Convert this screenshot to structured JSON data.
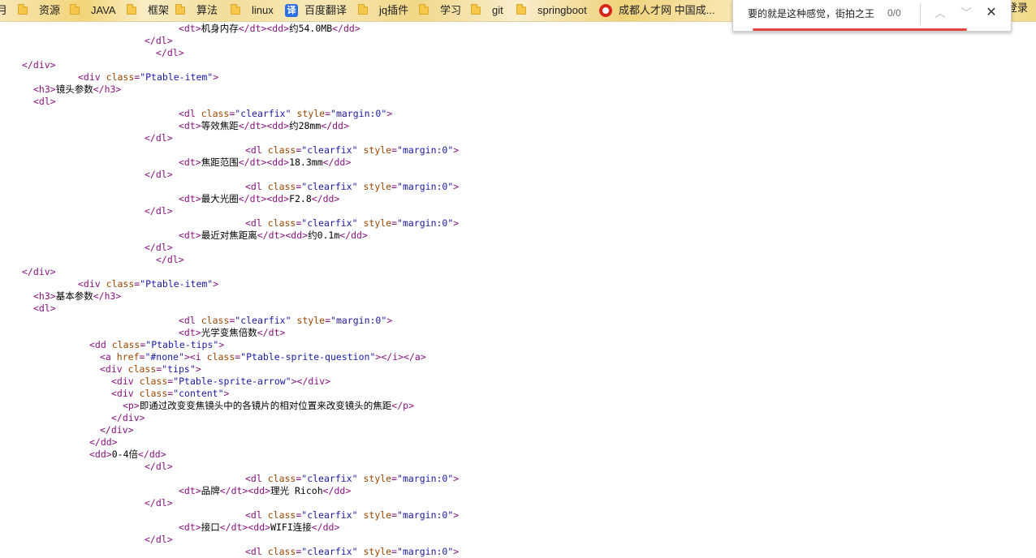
{
  "bookmarks": {
    "items": [
      {
        "label": "月",
        "icon": "folder-icon"
      },
      {
        "label": "资源",
        "icon": "folder-icon"
      },
      {
        "label": "JAVA",
        "icon": "folder-icon"
      },
      {
        "label": "框架",
        "icon": "folder-icon"
      },
      {
        "label": "算法",
        "icon": "folder-icon"
      },
      {
        "label": "linux",
        "icon": "folder-icon"
      },
      {
        "label": "百度翻译",
        "icon": "translate-icon"
      },
      {
        "label": "jq插件",
        "icon": "folder-icon"
      },
      {
        "label": "学习",
        "icon": "folder-icon"
      },
      {
        "label": "git",
        "icon": "folder-icon"
      },
      {
        "label": "springboot",
        "icon": "folder-icon"
      },
      {
        "label": "成都人才网 中国成...",
        "icon": "rencai-icon"
      }
    ],
    "translate_glyph": "译",
    "login": "登录"
  },
  "find_bar": {
    "query": "要的就是这种感觉，街拍之王",
    "count": "0/0",
    "prev_glyph": "︿",
    "next_glyph": "﹀",
    "close_glyph": "✕"
  },
  "source_lines": [
    {
      "indent": 32,
      "text": "<dt>机身内存</dt><dd>约54.0MB</dd>"
    },
    {
      "indent": 26,
      "text": "</dl>"
    },
    {
      "indent": 28,
      "text": "</dl>"
    },
    {
      "indent": 4,
      "text": "</div>"
    },
    {
      "indent": 14,
      "text": "<div class=\"Ptable-item\">"
    },
    {
      "indent": 6,
      "text": "<h3>镜头参数</h3>"
    },
    {
      "indent": 6,
      "text": "<dl>"
    },
    {
      "indent": 32,
      "text": "<dl class=\"clearfix\" style=\"margin:0\">"
    },
    {
      "indent": 32,
      "text": "<dt>等效焦距</dt><dd>约28mm</dd>"
    },
    {
      "indent": 26,
      "text": "</dl>"
    },
    {
      "indent": 44,
      "text": "<dl class=\"clearfix\" style=\"margin:0\">"
    },
    {
      "indent": 32,
      "text": "<dt>焦距范围</dt><dd>18.3mm</dd>"
    },
    {
      "indent": 26,
      "text": "</dl>"
    },
    {
      "indent": 44,
      "text": "<dl class=\"clearfix\" style=\"margin:0\">"
    },
    {
      "indent": 32,
      "text": "<dt>最大光圈</dt><dd>F2.8</dd>"
    },
    {
      "indent": 26,
      "text": "</dl>"
    },
    {
      "indent": 44,
      "text": "<dl class=\"clearfix\" style=\"margin:0\">"
    },
    {
      "indent": 32,
      "text": "<dt>最近对焦距离</dt><dd>约0.1m</dd>"
    },
    {
      "indent": 26,
      "text": "</dl>"
    },
    {
      "indent": 28,
      "text": "</dl>"
    },
    {
      "indent": 4,
      "text": "</div>"
    },
    {
      "indent": 14,
      "text": "<div class=\"Ptable-item\">"
    },
    {
      "indent": 6,
      "text": "<h3>基本参数</h3>"
    },
    {
      "indent": 6,
      "text": "<dl>"
    },
    {
      "indent": 32,
      "text": "<dl class=\"clearfix\" style=\"margin:0\">"
    },
    {
      "indent": 32,
      "text": "<dt>光学变焦倍数</dt>"
    },
    {
      "indent": 16,
      "text": "<dd class=\"Ptable-tips\">"
    },
    {
      "indent": 18,
      "text": "<a href=\"#none\"><i class=\"Ptable-sprite-question\"></i></a>"
    },
    {
      "indent": 18,
      "text": "<div class=\"tips\">"
    },
    {
      "indent": 20,
      "text": "<div class=\"Ptable-sprite-arrow\"></div>"
    },
    {
      "indent": 20,
      "text": "<div class=\"content\">"
    },
    {
      "indent": 22,
      "text": "<p>即通过改变变焦镜头中的各镜片的相对位置来改变镜头的焦距</p>"
    },
    {
      "indent": 20,
      "text": "</div>"
    },
    {
      "indent": 18,
      "text": "</div>"
    },
    {
      "indent": 16,
      "text": "</dd>"
    },
    {
      "indent": 16,
      "text": "<dd>0-4倍</dd>"
    },
    {
      "indent": 26,
      "text": "</dl>"
    },
    {
      "indent": 44,
      "text": "<dl class=\"clearfix\" style=\"margin:0\">"
    },
    {
      "indent": 32,
      "text": "<dt>品牌</dt><dd>理光 Ricoh</dd>"
    },
    {
      "indent": 26,
      "text": "</dl>"
    },
    {
      "indent": 44,
      "text": "<dl class=\"clearfix\" style=\"margin:0\">"
    },
    {
      "indent": 32,
      "text": "<dt>接口</dt><dd>WIFI连接</dd>"
    },
    {
      "indent": 26,
      "text": "</dl>"
    },
    {
      "indent": 44,
      "text": "<dl class=\"clearfix\" style=\"margin:0\">"
    }
  ]
}
